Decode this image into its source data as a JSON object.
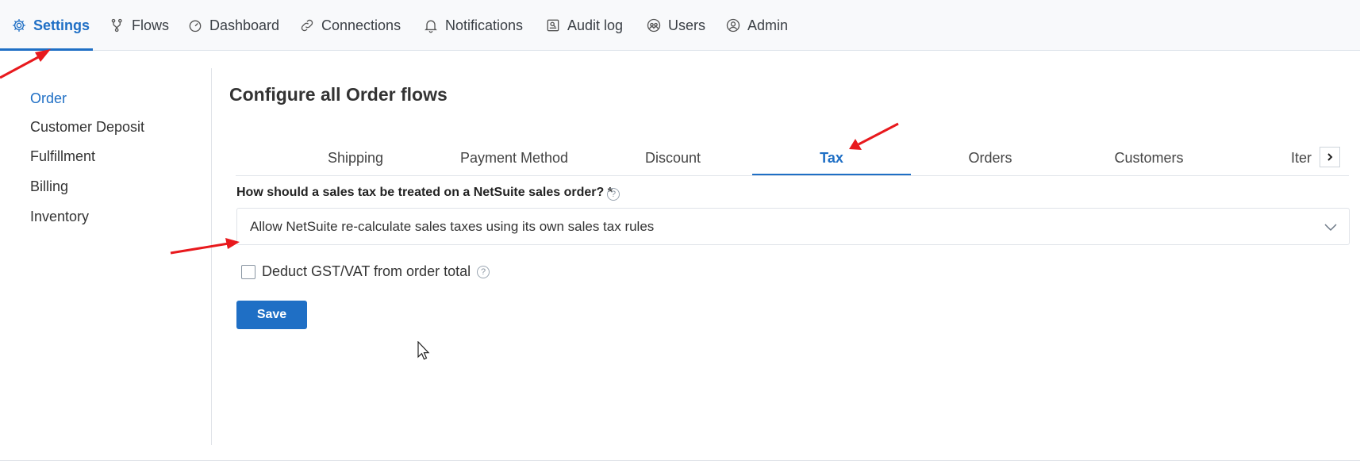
{
  "topnav": {
    "tabs": [
      {
        "label": "Settings",
        "icon": "gear-icon",
        "active": true
      },
      {
        "label": "Flows",
        "icon": "flows-icon"
      },
      {
        "label": "Dashboard",
        "icon": "dashboard-gauge-icon"
      },
      {
        "label": "Connections",
        "icon": "link-icon"
      },
      {
        "label": "Notifications",
        "icon": "bell-icon"
      },
      {
        "label": "Audit log",
        "icon": "audit-log-icon"
      },
      {
        "label": "Users",
        "icon": "users-icon"
      },
      {
        "label": "Admin",
        "icon": "admin-user-icon"
      }
    ]
  },
  "sidebar": {
    "items": [
      {
        "label": "Order",
        "active": true
      },
      {
        "label": "Customer Deposit"
      },
      {
        "label": "Fulfillment"
      },
      {
        "label": "Billing"
      },
      {
        "label": "Inventory"
      }
    ]
  },
  "main": {
    "title": "Configure all Order flows",
    "subtabs": [
      {
        "label": "Shipping"
      },
      {
        "label": "Payment Method"
      },
      {
        "label": "Discount"
      },
      {
        "label": "Tax",
        "active": true
      },
      {
        "label": "Orders"
      },
      {
        "label": "Customers"
      },
      {
        "label": "Iter"
      }
    ],
    "tax_treatment": {
      "label": "How should a sales tax be treated on a NetSuite sales order? *",
      "value": "Allow NetSuite re-calculate sales taxes using its own sales tax rules"
    },
    "deduct_gst": {
      "label": "Deduct GST/VAT from order total",
      "checked": false
    },
    "help_glyph": "?",
    "save_label": "Save"
  },
  "colors": {
    "accent": "#1f6fc5",
    "annotation": "#e8191d",
    "text": "#333333"
  }
}
